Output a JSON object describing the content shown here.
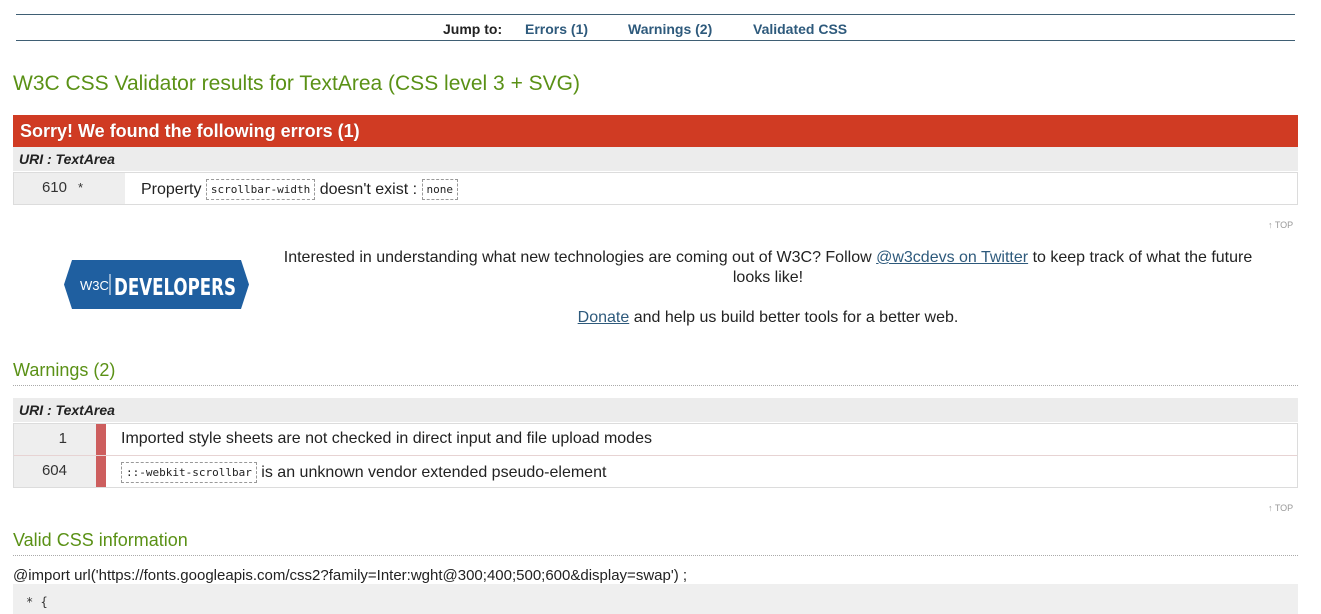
{
  "jump": {
    "label": "Jump to:",
    "links": [
      "Errors (1)",
      "Warnings (2)",
      "Validated CSS"
    ]
  },
  "title": "W3C CSS Validator results for TextArea (CSS level 3 + SVG)",
  "errors": {
    "header": "Sorry! We found the following errors (1)",
    "uri": "URI : TextArea",
    "rows": [
      {
        "line": "610",
        "context": "*",
        "pre": "Property",
        "code": "scrollbar-width",
        "mid": "doesn't exist :",
        "code2": "none"
      }
    ]
  },
  "top_link": "↑ TOP",
  "promo": {
    "logo_small": "W3C",
    "logo_text": "DEVELOPERS",
    "text_before": "Interested in understanding what new technologies are coming out of W3C? Follow",
    "twitter_link": "@w3cdevs on Twitter",
    "text_after": "to keep track of what the future looks like!",
    "donate_link": "Donate",
    "donate_after": "and help us build better tools for a better web."
  },
  "warnings": {
    "title": "Warnings (2)",
    "uri": "URI : TextArea",
    "rows": [
      {
        "line": "1",
        "text": "Imported style sheets are not checked in direct input and file upload modes"
      },
      {
        "line": "604",
        "code": "::-webkit-scrollbar",
        "text": "is an unknown vendor extended pseudo-element"
      }
    ]
  },
  "valid": {
    "title": "Valid CSS information",
    "import_line": "@import url('https://fonts.googleapis.com/css2?family=Inter:wght@300;400;500;600&display=swap') ;",
    "code_first_line": "* {"
  },
  "colors": {
    "accent_green": "#5a9116",
    "error_red": "#d03b23",
    "link_blue": "#2e5a7c",
    "warning_bar": "#cd5e5e",
    "logo_blue": "#1f5fa0"
  }
}
